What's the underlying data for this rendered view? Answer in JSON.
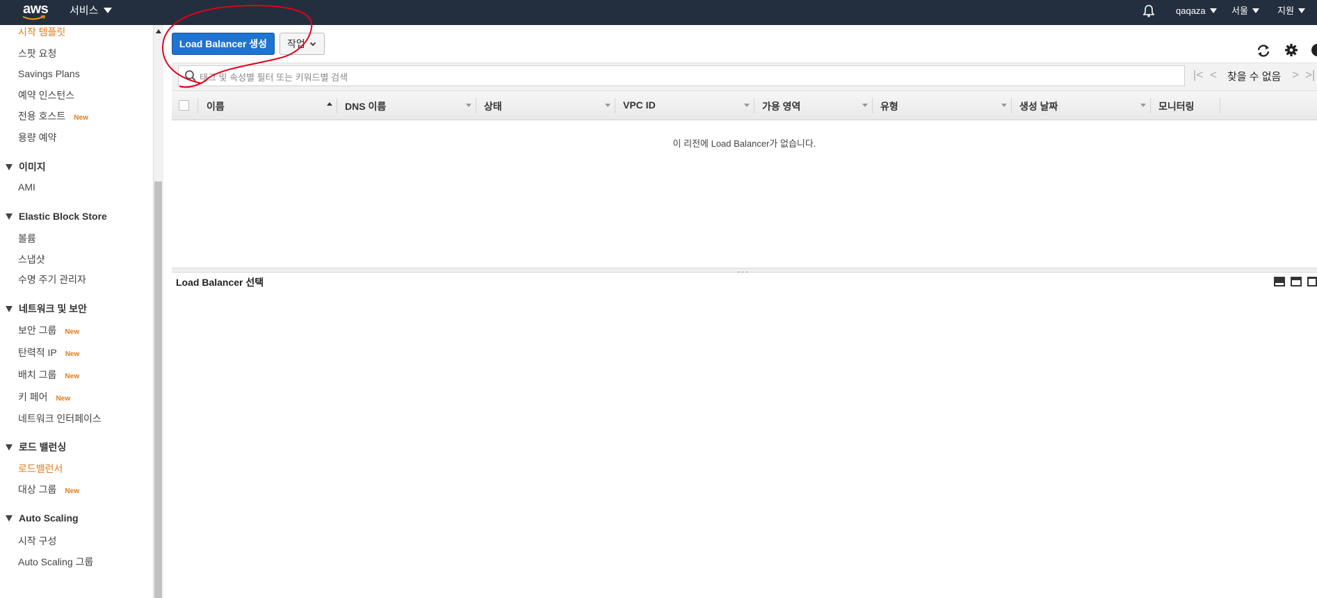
{
  "topnav": {
    "logo": "aws",
    "services_label": "서비스",
    "bell_icon": "bell-icon",
    "account_label": "qaqaza",
    "region_label": "서울",
    "support_label": "지원"
  },
  "sidebar": {
    "items_top": [
      {
        "label": "시작 템플릿",
        "active": true
      },
      {
        "label": "스팟 요청"
      },
      {
        "label": "Savings Plans"
      },
      {
        "label": "예약 인스턴스"
      },
      {
        "label": "전용 호스트",
        "badge": "New"
      },
      {
        "label": "용량 예약"
      }
    ],
    "sections": [
      {
        "title": "이미지",
        "items": [
          {
            "label": "AMI"
          }
        ]
      },
      {
        "title": "Elastic Block Store",
        "items": [
          {
            "label": "볼륨"
          },
          {
            "label": "스냅샷"
          },
          {
            "label": "수명 주기 관리자"
          }
        ]
      },
      {
        "title": "네트워크 및 보안",
        "items": [
          {
            "label": "보안 그룹",
            "badge": "New"
          },
          {
            "label": "탄력적 IP",
            "badge": "New"
          },
          {
            "label": "배치 그룹",
            "badge": "New"
          },
          {
            "label": "키 페어",
            "badge": "New"
          },
          {
            "label": "네트워크 인터페이스"
          }
        ]
      },
      {
        "title": "로드 밸런싱",
        "items": [
          {
            "label": "로드밸런서",
            "active": true
          },
          {
            "label": "대상 그룹",
            "badge": "New"
          }
        ]
      },
      {
        "title": "Auto Scaling",
        "items": [
          {
            "label": "시작 구성"
          },
          {
            "label": "Auto Scaling 그룹"
          }
        ]
      }
    ]
  },
  "toolbar": {
    "create_label": "Load Balancer 생성",
    "actions_label": "작업",
    "refresh_icon": "refresh-icon",
    "settings_icon": "gear-icon",
    "help_icon": "help-icon"
  },
  "filter": {
    "placeholder": "태그 및 속성별 필터 또는 키워드별 검색",
    "pager_text": "찾을 수 없음"
  },
  "table": {
    "columns": [
      "이름",
      "DNS 이름",
      "상태",
      "VPC ID",
      "가용 영역",
      "유형",
      "생성 날짜",
      "모니터링"
    ],
    "empty_message": "이 리전에 Load Balancer가 없습니다."
  },
  "detail": {
    "title": "Load Balancer 선택"
  },
  "colors": {
    "nav_bg": "#232f3e",
    "primary_button": "#1f73d1",
    "active_link": "#e07b18",
    "annotation": "#e0001a"
  }
}
